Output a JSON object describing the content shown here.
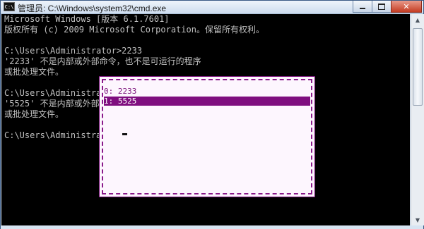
{
  "window": {
    "title": "管理员: C:\\Windows\\system32\\cmd.exe",
    "icon_label": "C:\\",
    "icon": "cmd-icon",
    "controls": [
      "minimize-icon",
      "maximize-icon",
      "close-icon"
    ],
    "close_glyph": "✕"
  },
  "console": {
    "lines": [
      "Microsoft Windows [版本 6.1.7601]",
      "版权所有 (c) 2009 Microsoft Corporation。保留所有权利。",
      "",
      "C:\\Users\\Administrator>2233",
      "'2233' 不是内部或外部命令，也不是可运行的程序",
      "或批处理文件。",
      "",
      "C:\\Users\\Administrator>5525",
      "'5525' 不是内部或外部命令，也不是可运行的程序",
      "或批处理文件。",
      "",
      "C:\\Users\\Administrator>"
    ]
  },
  "history_popup": {
    "items": [
      "0: 2233",
      "1: 5525"
    ],
    "selected_index": 1,
    "colors": {
      "text": "#7b147b",
      "highlight": "#7f0e7f",
      "background": "#fdf6fe"
    }
  },
  "scrollbar": {
    "up_glyph": "▲",
    "down_glyph": "▼"
  }
}
